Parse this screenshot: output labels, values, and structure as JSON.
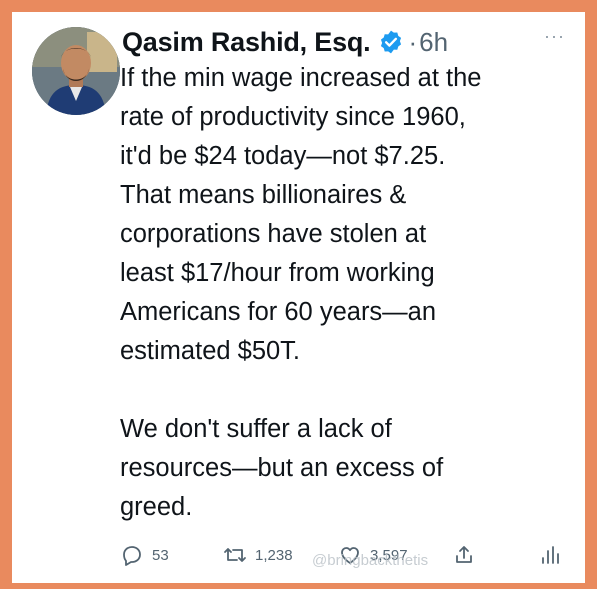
{
  "tweet": {
    "author_name": "Qasim Rashid, Esq.",
    "separator": "·",
    "time": "6h",
    "more_label": "···",
    "lines_para1": [
      "If the min wage increased at the",
      "rate of productivity since 1960,",
      "it'd be $24 today—not $7.25.",
      "That means billionaires &",
      "corporations have stolen at",
      "least $17/hour from working",
      "Americans for 60 years—an",
      "estimated $50T."
    ],
    "lines_para2": [
      "We don't suffer a lack of",
      "resources—but an excess of",
      "greed."
    ]
  },
  "actions": {
    "replies": "53",
    "retweets": "1,238",
    "likes": "3,597"
  },
  "icons": {
    "verified": "verified-badge-icon",
    "reply": "reply-icon",
    "retweet": "retweet-icon",
    "like": "heart-icon",
    "share": "share-icon",
    "analytics": "analytics-icon"
  },
  "colors": {
    "frame": "#e98a5e",
    "verified": "#1d9bf0",
    "text": "#0f1419",
    "muted": "#536471"
  },
  "watermark": "@bringbackthetis"
}
